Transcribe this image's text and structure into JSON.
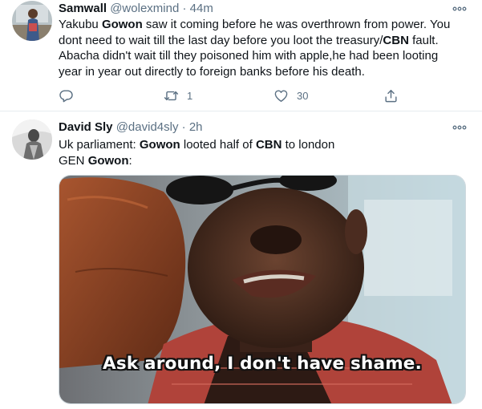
{
  "tweets": [
    {
      "author_name": "Samwall",
      "handle": "@wolexmind",
      "separator": "·",
      "time": "44m",
      "text_lines": [
        [
          {
            "t": "Yakubu ",
            "b": false
          },
          {
            "t": "Gowon",
            "b": true
          },
          {
            "t": " saw it coming before he was overthrown from power. You",
            "b": false
          }
        ],
        [
          {
            "t": "dont need to wait till the last day before you loot the treasury/",
            "b": false
          },
          {
            "t": "CBN",
            "b": true
          },
          {
            "t": " fault.",
            "b": false
          }
        ],
        [
          {
            "t": "Abacha didn't wait till they poisoned him with apple,he had been looting",
            "b": false
          }
        ],
        [
          {
            "t": "year in year out directly to foreign banks before his death.",
            "b": false
          }
        ]
      ],
      "actions": {
        "reply": {
          "icon": "reply-icon",
          "count": ""
        },
        "retweet": {
          "icon": "retweet-icon",
          "count": "1"
        },
        "like": {
          "icon": "heart-icon",
          "count": "30"
        },
        "share": {
          "icon": "share-icon",
          "count": ""
        }
      }
    },
    {
      "author_name": "David Sly",
      "handle": "@david4sly",
      "separator": "·",
      "time": "2h",
      "text_lines": [
        [
          {
            "t": "Uk parliament: ",
            "b": false
          },
          {
            "t": "Gowon",
            "b": true
          },
          {
            "t": " looted half of ",
            "b": false
          },
          {
            "t": "CBN",
            "b": true
          },
          {
            "t": " to london",
            "b": false
          }
        ],
        [
          {
            "t": "GEN ",
            "b": false
          },
          {
            "t": "Gowon",
            "b": true
          },
          {
            "t": ":",
            "b": false
          }
        ]
      ],
      "media": {
        "caption": "Ask around, I don't have shame."
      }
    }
  ],
  "colors": {
    "text": "#0f1419",
    "secondary": "#5b7083",
    "divider": "#e6ecf0"
  }
}
